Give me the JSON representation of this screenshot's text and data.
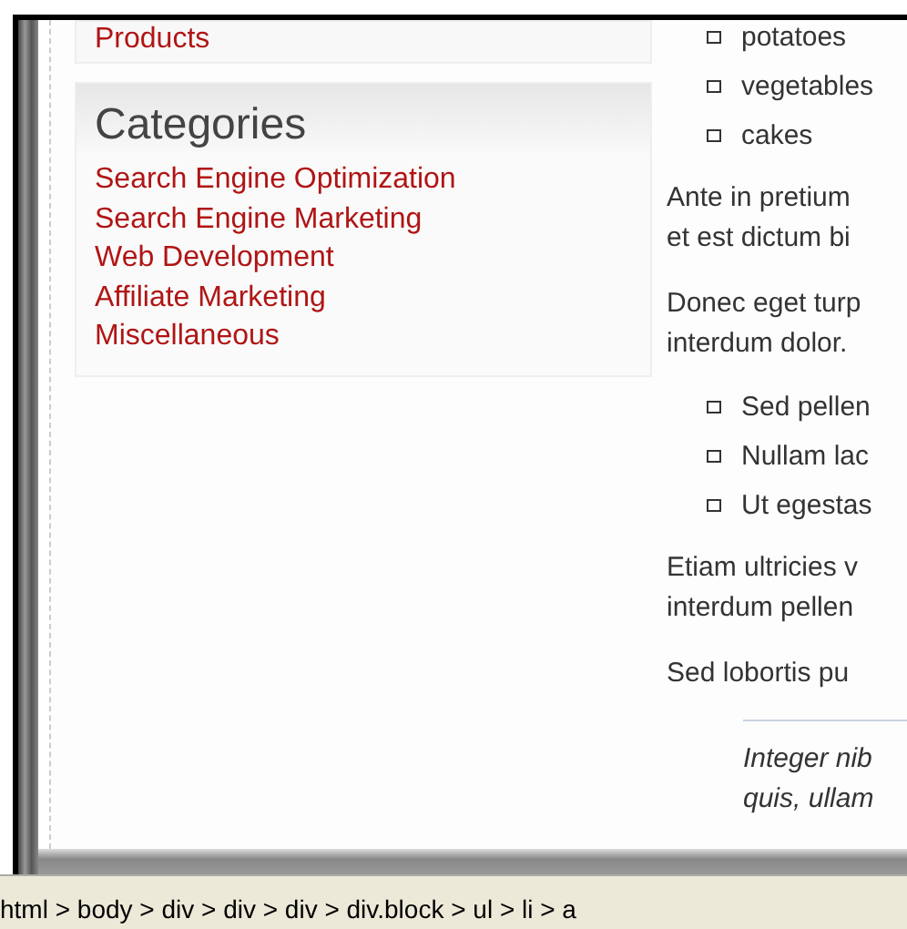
{
  "sidebar": {
    "top_link": "Products",
    "categories": {
      "title": "Categories",
      "links": [
        {
          "label": "Search Engine Optimization"
        },
        {
          "label": "Search Engine Marketing"
        },
        {
          "label": "Web Development"
        },
        {
          "label": "Affiliate Marketing"
        },
        {
          "label": "Miscellaneous"
        }
      ]
    }
  },
  "content": {
    "blocks": [
      {
        "kind": "list",
        "items": [
          "potatoes",
          "vegetables",
          "cakes"
        ]
      },
      {
        "kind": "paragraph",
        "lines": [
          "Ante in pretium",
          "et est dictum bi"
        ]
      },
      {
        "kind": "paragraph",
        "lines": [
          "Donec eget turp",
          "interdum dolor."
        ]
      },
      {
        "kind": "list",
        "items": [
          "Sed pellen",
          "Nullam lac",
          "Ut egestas"
        ]
      },
      {
        "kind": "paragraph",
        "lines": [
          "Etiam ultricies v",
          "interdum pellen"
        ]
      },
      {
        "kind": "paragraph",
        "lines": [
          "Sed lobortis pu"
        ]
      },
      {
        "kind": "quote",
        "lines": [
          "Integer nib",
          "quis, ullam"
        ]
      }
    ]
  },
  "status_bar": {
    "path": "html > body > div > div > div > div.block > ul > li > a"
  }
}
